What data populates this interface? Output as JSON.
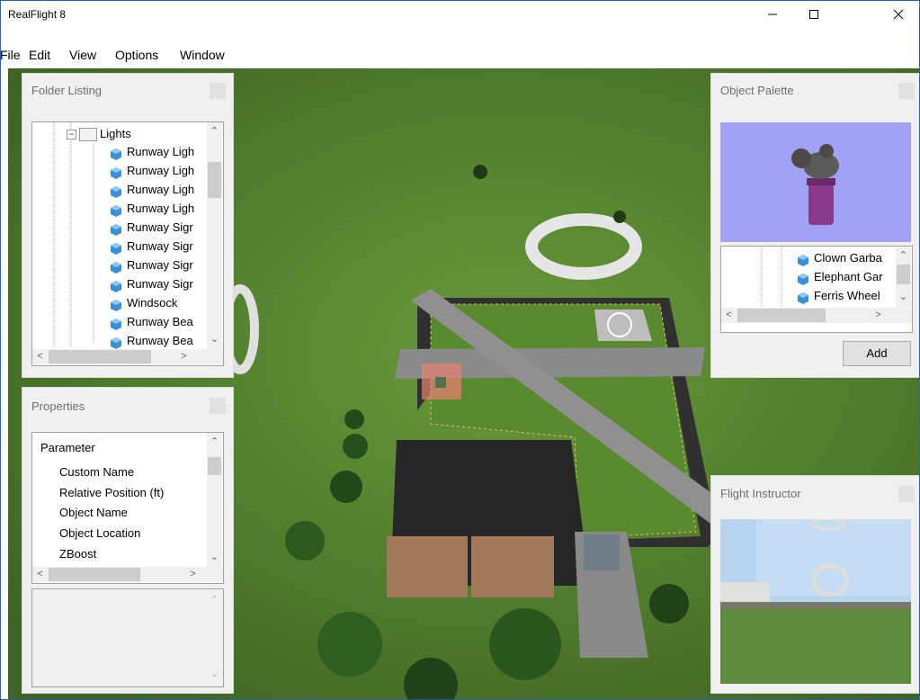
{
  "window": {
    "title": "RealFlight 8"
  },
  "menu": [
    {
      "label": "File"
    },
    {
      "label": "Edit"
    },
    {
      "label": "View"
    },
    {
      "label": "Options"
    },
    {
      "label": "Window"
    }
  ],
  "folder_listing": {
    "title": "Folder Listing",
    "folder": "Lights",
    "items": [
      "Runway Ligh",
      "Runway Ligh",
      "Runway Ligh",
      "Runway Ligh",
      "Runway Sigr",
      "Runway Sigr",
      "Runway Sigr",
      "Runway Sigr",
      "Windsock",
      "Runway Bea",
      "Runway Bea"
    ]
  },
  "properties": {
    "title": "Properties",
    "header": "Parameter",
    "items": [
      "Custom Name",
      "Relative Position (ft)",
      "Object Name",
      "Object Location",
      "ZBoost"
    ]
  },
  "object_palette": {
    "title": "Object Palette",
    "items": [
      "Clown Garba",
      "Elephant Gar",
      "Ferris Wheel"
    ],
    "add_label": "Add"
  },
  "flight_instructor": {
    "title": "Flight Instructor"
  },
  "colors": {
    "accent": "#1e64b4",
    "grass": "#4e7a28",
    "cube": "#3a8fd6"
  }
}
